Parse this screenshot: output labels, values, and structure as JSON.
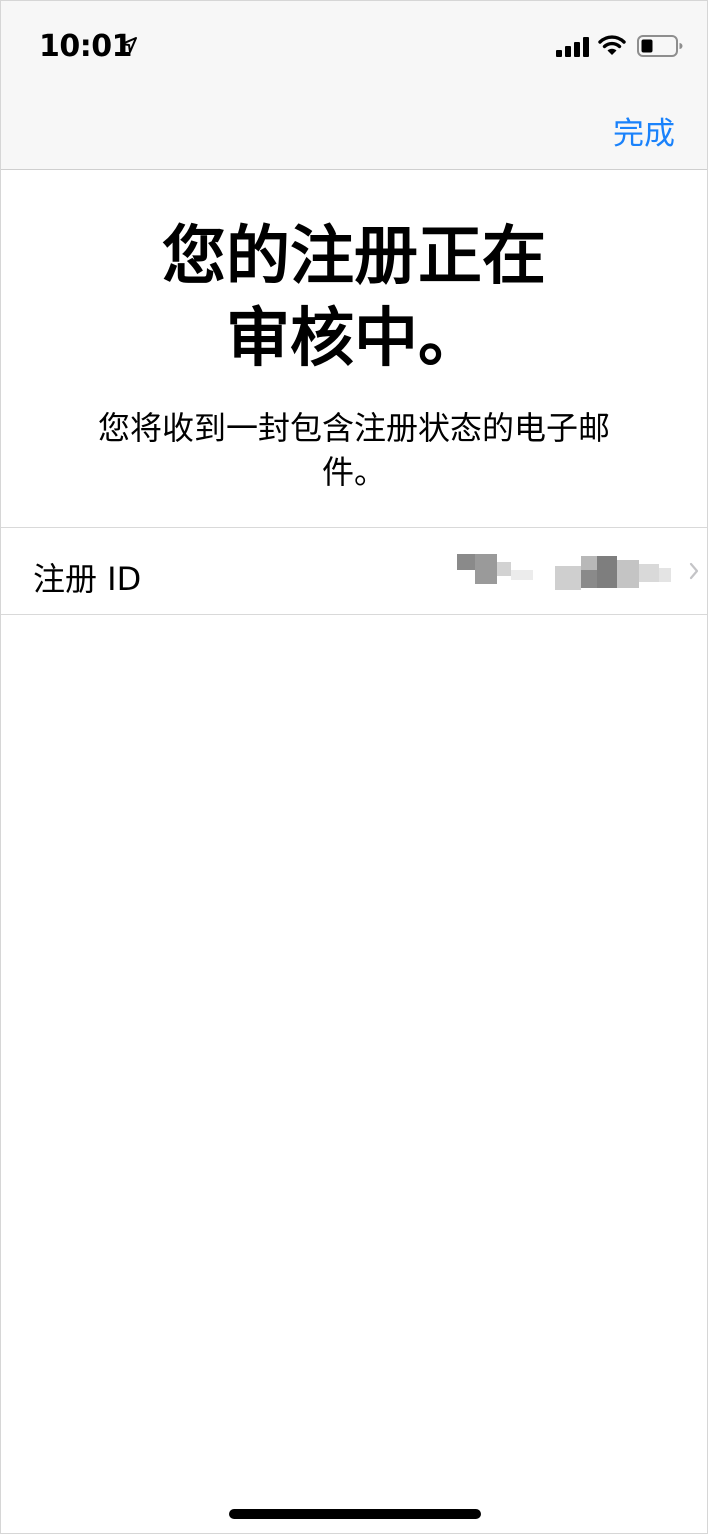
{
  "status_bar": {
    "time": "10:01",
    "icons": [
      "location-arrow-icon",
      "cellular-signal-icon",
      "wifi-icon",
      "battery-icon"
    ]
  },
  "nav": {
    "done_label": "完成",
    "accent_color": "#1a82fb"
  },
  "main": {
    "title_line1": "您的注册正在",
    "title_line2": "审核中。",
    "subtitle_line1": "您将收到一封包含注册状态的电子邮",
    "subtitle_line2": "件。"
  },
  "enrollment_row": {
    "label": "注册 ID",
    "value_icon": "redacted-pixelated-value",
    "chevron_icon": "chevron-right-icon"
  }
}
